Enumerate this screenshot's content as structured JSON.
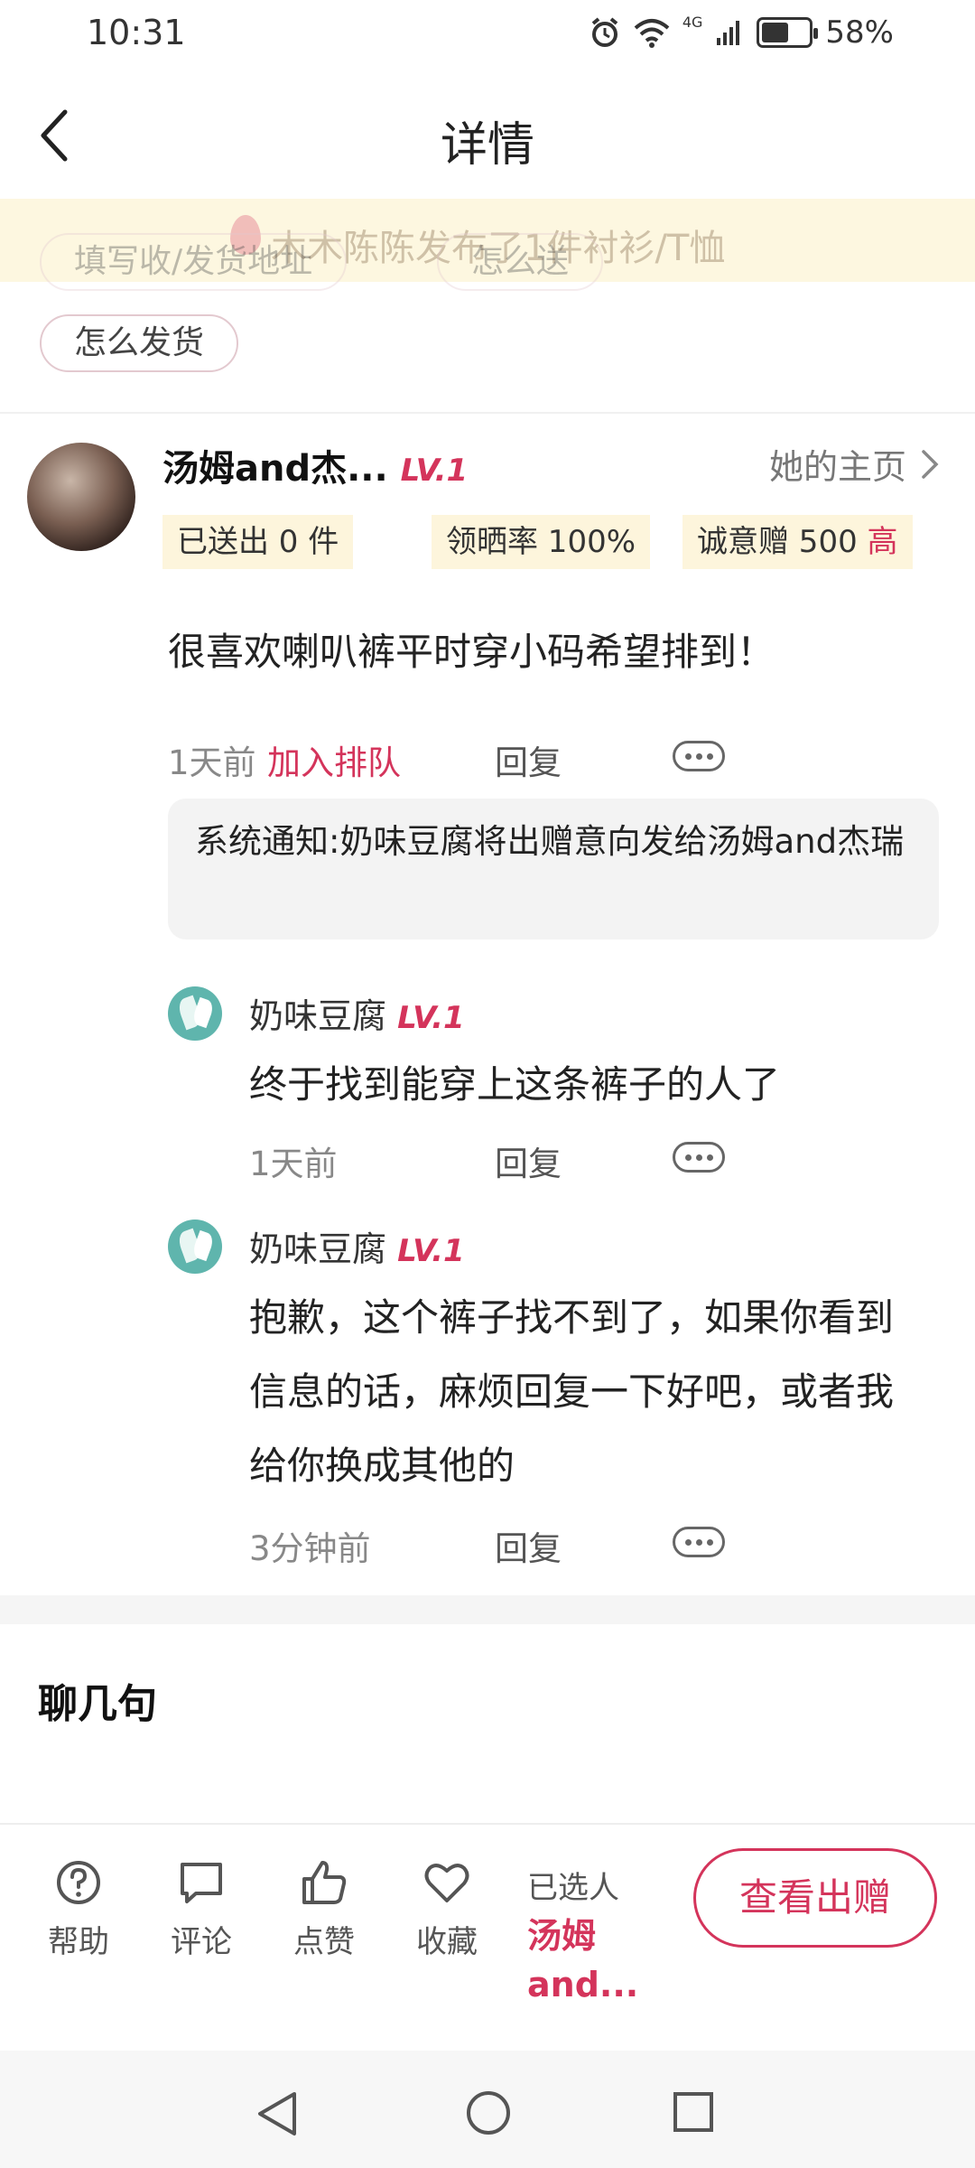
{
  "status_bar": {
    "time": "10:31",
    "network": "4G",
    "battery_percent": "58%",
    "battery_level": 0.58
  },
  "header": {
    "title": "详情"
  },
  "banner": {
    "text": "木木陈陈发布了1件衬衫/T恤"
  },
  "quick_chips": [
    "填写收/发货地址",
    "怎么送",
    "怎么发货"
  ],
  "comment": {
    "username": "汤姆and杰...",
    "level": "LV.1",
    "homepage_label": "她的主页",
    "stats": {
      "sent": "已送出 0 件",
      "show_rate": "领晒率 100%",
      "sincerity": "诚意赠 500",
      "sincerity_tag": "高"
    },
    "content": "很喜欢喇叭裤平时穿小码希望排到！",
    "time": "1天前",
    "join_label": "加入排队",
    "reply_label": "回复",
    "system_notice": "系统通知:奶味豆腐将出赠意向发给汤姆and杰瑞",
    "replies": [
      {
        "name": "奶味豆腐",
        "level": "LV.1",
        "text": "终于找到能穿上这条裤子的人了",
        "time": "1天前"
      },
      {
        "name": "奶味豆腐",
        "level": "LV.1",
        "text": "抱歉，这个裤子找不到了，如果你看到信息的话，麻烦回复一下好吧，或者我给你换成其他的",
        "time": "3分钟前"
      }
    ]
  },
  "chat_section": {
    "title": "聊几句"
  },
  "action_bar": {
    "help": "帮助",
    "comment": "评论",
    "like": "点赞",
    "favorite": "收藏",
    "selected_label": "已选人",
    "selected_name": "汤姆and...",
    "view_button": "查看出赠"
  },
  "colors": {
    "accent": "#d4345b",
    "banner_bg": "#fdf7e0",
    "stat_bg": "#fdf5dc"
  }
}
